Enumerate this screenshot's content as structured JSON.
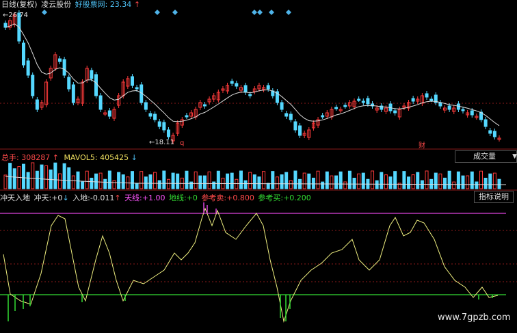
{
  "header": {
    "period_label": "日线(复权)",
    "stock_name": "凌云股份",
    "source_label": "好股票网:",
    "source_value": "23.34",
    "source_arrow": "↑"
  },
  "price_panel": {
    "high_label": "26.74",
    "low_label": "18.11",
    "marker_q": "q",
    "marker_cai": "财"
  },
  "volume_panel": {
    "total_label": "总手:",
    "total_value": "308287",
    "total_arrow": "↑",
    "ma_label": "MAVOL5:",
    "ma_value": "405425",
    "ma_arrow": "↓",
    "button_label": "成交量",
    "dropdown_icon": "triangle-down-icon"
  },
  "indicator_panel": {
    "name": "冲天入地",
    "chongtian_label": "冲天:",
    "chongtian_value": "+0",
    "chongtian_arrow": "↓",
    "rudi_label": "入地:",
    "rudi_value": "-0.011",
    "rudi_arrow": "↑",
    "tianxian_label": "天线:",
    "tianxian_value": "+1.00",
    "dixian_label": "地线:",
    "dixian_value": "+0",
    "sell_label": "参考卖:",
    "sell_value": "+0.800",
    "buy_label": "参考买:",
    "buy_value": "+0.200",
    "button_label": "指标说明"
  },
  "watermark": "www.7gpzb.com",
  "colors": {
    "up": "#ff3b3b",
    "down": "#55d8ff",
    "line": "#f0f080",
    "magenta": "#dd44dd",
    "green": "#33dd33",
    "grid": "#8b1a1a"
  }
}
